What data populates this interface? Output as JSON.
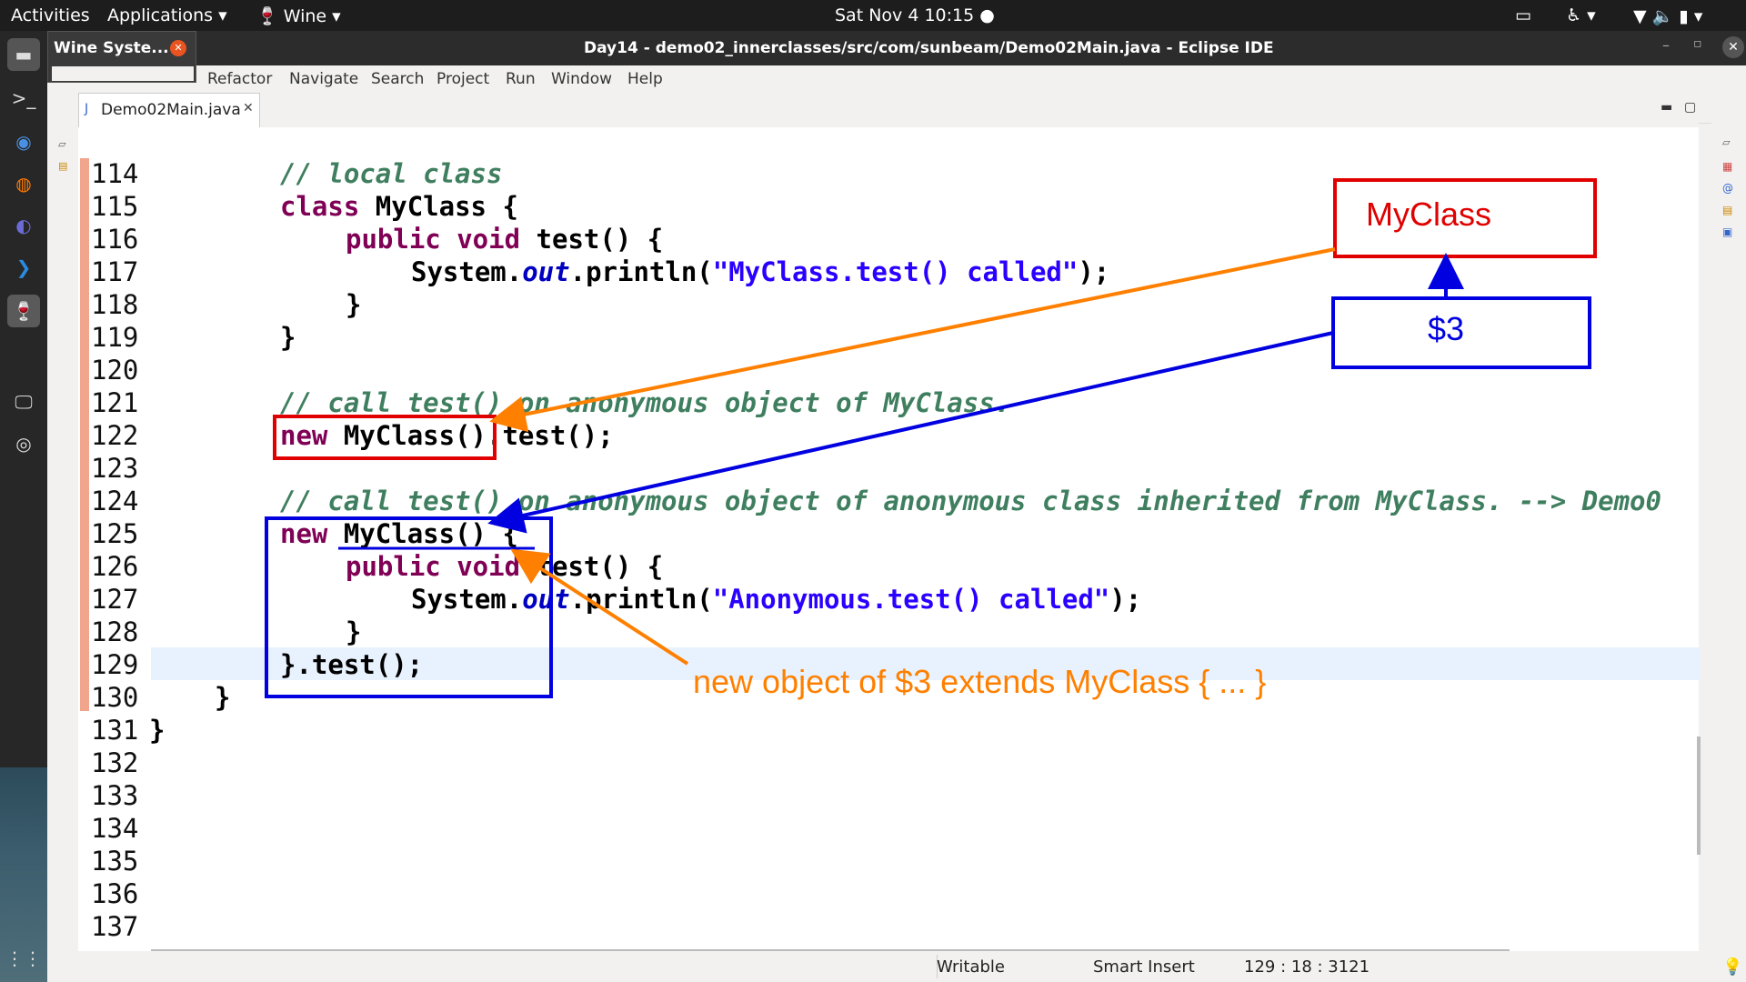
{
  "topbar": {
    "activities": "Activities",
    "applications": "Applications",
    "wine": "Wine",
    "clock": "Sat Nov 4  10:15"
  },
  "wine_popup": {
    "title": "Wine Syste..."
  },
  "window": {
    "title": "Day14 - demo02_innerclasses/src/com/sunbeam/Demo02Main.java - Eclipse IDE"
  },
  "menu": [
    "Refactor",
    "Navigate",
    "Search",
    "Project",
    "Run",
    "Window",
    "Help"
  ],
  "editor_tab": {
    "label": "Demo02Main.java"
  },
  "line_numbers": [
    "114",
    "115",
    "116",
    "117",
    "118",
    "119",
    "120",
    "121",
    "122",
    "123",
    "124",
    "125",
    "126",
    "127",
    "128",
    "129",
    "130",
    "131",
    "132",
    "133",
    "134",
    "135",
    "136",
    "137"
  ],
  "code": {
    "l114": "// local class",
    "l115_kw": "class",
    "l115_rest": " MyClass {",
    "l116_kw": "public void",
    "l116_rest": " test() {",
    "l117_a": "System.",
    "l117_out": "out",
    "l117_b": ".println(",
    "l117_str": "\"MyClass.test() called\"",
    "l117_c": ");",
    "l118": "}",
    "l119": "}",
    "l121": "// call test() on anonymous object of MyClass.",
    "l122_kw": "new",
    "l122_rest": " MyClass().test();",
    "l124": "// call test() on anonymous object of anonymous class inherited from MyClass. --> Demo0",
    "l125_kw": "new",
    "l125_rest": " MyClass() {",
    "l126_kw": "public void",
    "l126_rest": " test() {",
    "l127_a": "System.",
    "l127_out": "out",
    "l127_b": ".println(",
    "l127_str": "\"Anonymous.test() called\"",
    "l127_c": ");",
    "l128": "}",
    "l129": "}.test();",
    "l130": "}",
    "l131": "}"
  },
  "annotations": {
    "myclass_box": "MyClass",
    "dollar3_box": "$3",
    "note": "new object of $3 extends MyClass { ... }",
    "colors": {
      "red": "#e00000",
      "blue": "#0000e0",
      "orange": "#ff8000"
    }
  },
  "status": {
    "mode": "Writable",
    "insert": "Smart Insert",
    "position": "129 : 18 : 3121"
  }
}
